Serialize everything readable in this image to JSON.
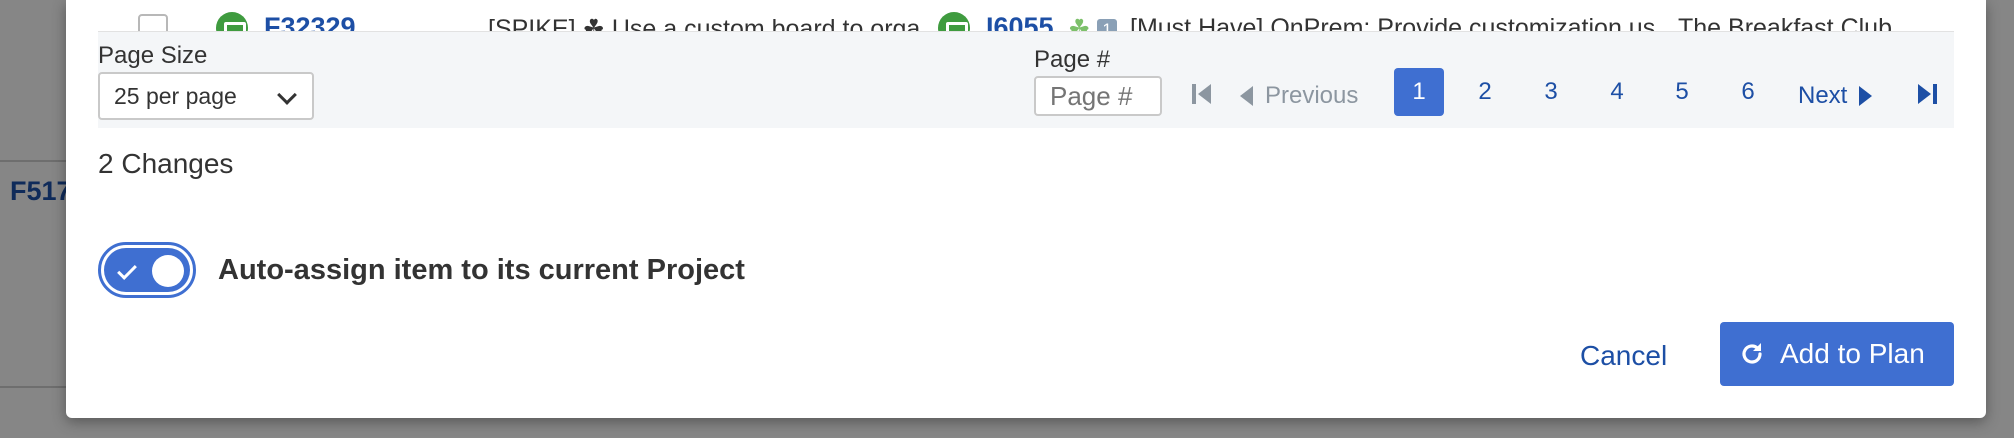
{
  "background": {
    "partial_id": "F517"
  },
  "table_row": {
    "item_id": "F32329",
    "item_title": "[SPIKE] ☘ Use a custom board to orga",
    "parent_id": "I6055",
    "parent_title": "[Must Have] OnPrem: Provide customization us",
    "parent_badge": "1",
    "team": "The Breakfast Club"
  },
  "pagination": {
    "page_size_label": "Page Size",
    "page_size_value": "25 per page",
    "page_number_label": "Page #",
    "page_number_placeholder": "Page #",
    "previous_label": "Previous",
    "next_label": "Next",
    "pages": [
      "1",
      "2",
      "3",
      "4",
      "5",
      "6"
    ],
    "current_page": "1"
  },
  "changes_text": "2 Changes",
  "auto_assign": {
    "label": "Auto-assign item to its current Project",
    "enabled": true
  },
  "actions": {
    "cancel_label": "Cancel",
    "add_label": "Add to Plan"
  },
  "colors": {
    "accent": "#3f6fd1",
    "link": "#1d4fa5",
    "feature_icon": "#3f9b3f"
  }
}
